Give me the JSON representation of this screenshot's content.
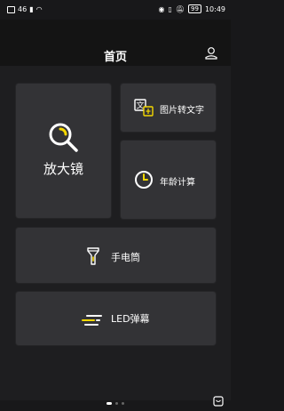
{
  "status_bar": {
    "carrier": "46",
    "time": "10:49",
    "battery": "99"
  },
  "header": {
    "title": "首页",
    "user_icon": "user-icon"
  },
  "cards": {
    "magnifier": {
      "label": "放大镜",
      "icon": "magnifier-icon"
    },
    "image_to_text": {
      "label": "图片转文字",
      "icon": "image-to-text-icon"
    },
    "age_calculator": {
      "label": "年龄计算",
      "icon": "clock-icon"
    },
    "flashlight": {
      "label": "手电筒",
      "icon": "flashlight-icon"
    },
    "led_banner": {
      "label": "LED弹幕",
      "icon": "led-lines-icon"
    }
  },
  "pager": {
    "count": 3,
    "active_index": 0
  },
  "colors": {
    "accent": "#f5d800",
    "card": "#333336",
    "background": "#1e1e20",
    "header": "#141414"
  }
}
